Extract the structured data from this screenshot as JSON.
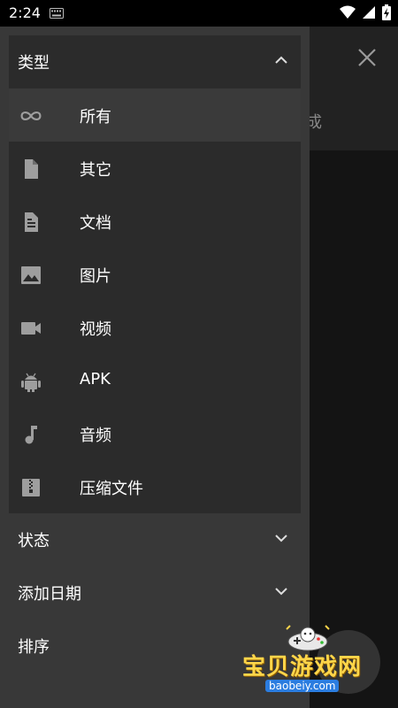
{
  "status": {
    "time": "2:24"
  },
  "background": {
    "partial_text": "成"
  },
  "drawer": {
    "type_section": {
      "title": "类型",
      "items": [
        {
          "label": "所有",
          "icon": "infinity-icon",
          "selected": true
        },
        {
          "label": "其它",
          "icon": "file-icon"
        },
        {
          "label": "文档",
          "icon": "document-icon"
        },
        {
          "label": "图片",
          "icon": "image-icon"
        },
        {
          "label": "视频",
          "icon": "video-icon"
        },
        {
          "label": "APK",
          "icon": "android-icon"
        },
        {
          "label": "音频",
          "icon": "music-note-icon"
        },
        {
          "label": "压缩文件",
          "icon": "zip-icon"
        }
      ]
    },
    "status_section": {
      "title": "状态"
    },
    "date_section": {
      "title": "添加日期"
    },
    "sort_section": {
      "title": "排序"
    }
  },
  "watermark": {
    "title": "宝贝游戏网",
    "site": "baobeiy.com"
  },
  "colors": {
    "drawer_bg": "#383838",
    "panel_bg": "#2b2b2b",
    "icon_grey": "#9e9e9e",
    "watermark_yellow": "#ffd64a"
  }
}
